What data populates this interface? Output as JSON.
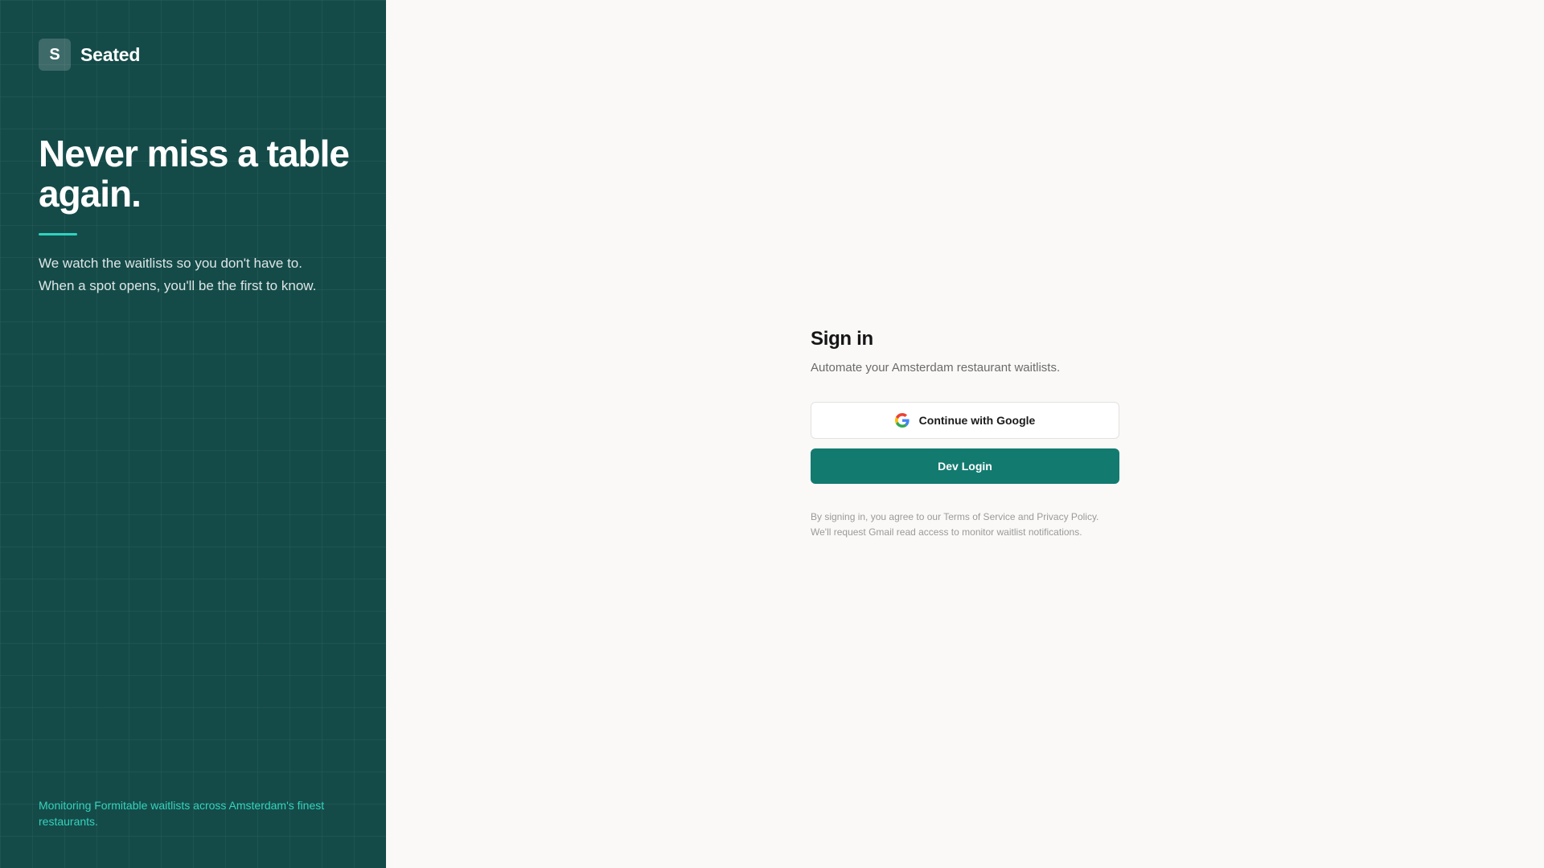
{
  "brand": {
    "logo_letter": "S",
    "name": "Seated"
  },
  "hero": {
    "headline": "Never miss a table again.",
    "tagline_line1": "We watch the waitlists so you don't have to.",
    "tagline_line2": "When a spot opens, you'll be the first to know."
  },
  "footer_note": "Monitoring Formitable waitlists across Amsterdam's finest restaurants.",
  "signin": {
    "title": "Sign in",
    "subtitle": "Automate your Amsterdam restaurant waitlists.",
    "google_label": "Continue with Google",
    "dev_label": "Dev Login",
    "legal": "By signing in, you agree to our Terms of Service and Privacy Policy. We'll request Gmail read access to monitor waitlist notifications."
  },
  "icons": {
    "brand_logo": "letter-badge",
    "google": "google-g-icon"
  },
  "colors": {
    "brand_panel": "#144b49",
    "accent": "#2dd4bf",
    "primary_button": "#137a70",
    "background": "#faf9f7"
  }
}
